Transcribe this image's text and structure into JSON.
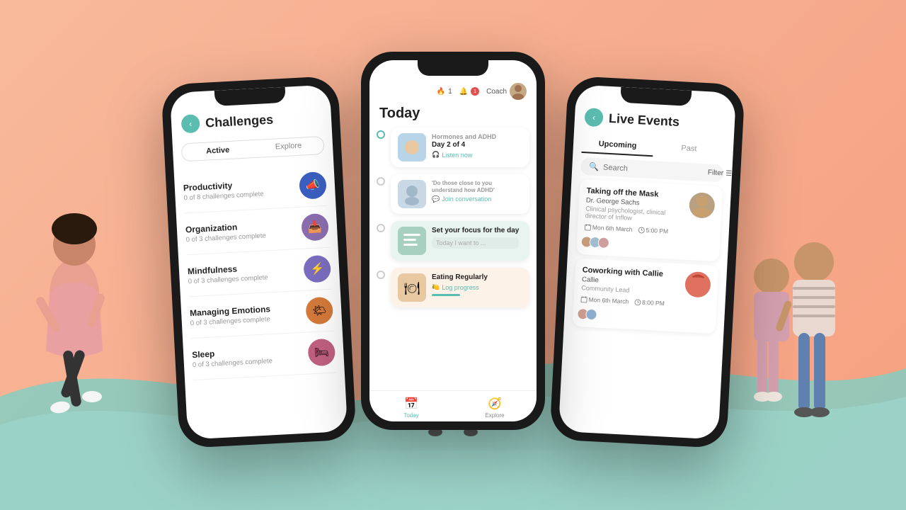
{
  "background": {
    "peach_color": "#f5a080",
    "teal_color": "#7ecfc4"
  },
  "phone1": {
    "title": "Challenges",
    "tabs": [
      "Active",
      "Explore"
    ],
    "active_tab": "Active",
    "challenges": [
      {
        "name": "Productivity",
        "progress": "0 of 8 challenges complete",
        "icon": "📣",
        "icon_color": "#3b5fc0"
      },
      {
        "name": "Organization",
        "progress": "0 of 3 challenges complete",
        "icon": "📥",
        "icon_color": "#8b6daf"
      },
      {
        "name": "Mindfulness",
        "progress": "0 of 3 challenges complete",
        "icon": "⚡",
        "icon_color": "#7b6dbf"
      },
      {
        "name": "Managing Emotions",
        "progress": "0 of 3 challenges complete",
        "icon": "🌤",
        "icon_color": "#d47a3a"
      },
      {
        "name": "Sleep",
        "progress": "0 of 3 challenges complete",
        "icon": "🛏",
        "icon_color": "#c06080"
      }
    ]
  },
  "phone2": {
    "title": "Today",
    "topbar": {
      "streak": "1",
      "notification_badge": "1",
      "coach_label": "Coach"
    },
    "timeline_items": [
      {
        "type": "audio",
        "subtitle": "Hormones and ADHD",
        "title": "Day 2 of 4",
        "action": "Listen now",
        "thumb_color": "#b8d4e8"
      },
      {
        "type": "conversation",
        "subtitle": "'Do those close to you understand how ADHD'",
        "title": "",
        "action": "Join conversation",
        "thumb_color": "#b8c8d4"
      },
      {
        "type": "focus",
        "title": "Set your focus for the day",
        "placeholder": "Today I want to ...",
        "thumb_color": "#a8d0c0"
      },
      {
        "type": "food",
        "title": "Eating Regularly",
        "action": "Log progress",
        "action_emoji": "🍋",
        "thumb_color": "#e8c8a0"
      }
    ],
    "nav": [
      {
        "label": "Today",
        "icon": "📅",
        "active": true
      },
      {
        "label": "Explore",
        "icon": "🔍",
        "active": false
      }
    ]
  },
  "phone3": {
    "title": "Live Events",
    "tabs": [
      "Upcoming",
      "Past"
    ],
    "active_tab": "Upcoming",
    "search_placeholder": "Search",
    "filter_label": "Filter",
    "events": [
      {
        "title": "Taking off the Mask",
        "speaker": "Dr. George Sachs",
        "role": "Clinical psychologist, clinical director of Inflow",
        "date": "Mon 6th March",
        "time": "5:00 PM",
        "avatar_color": "#c5a885"
      },
      {
        "title": "Coworking with Callie",
        "speaker": "Callie",
        "role": "Community Lead",
        "date": "Mon 6th March",
        "time": "8:00 PM",
        "avatar_color": "#e07060"
      }
    ]
  }
}
